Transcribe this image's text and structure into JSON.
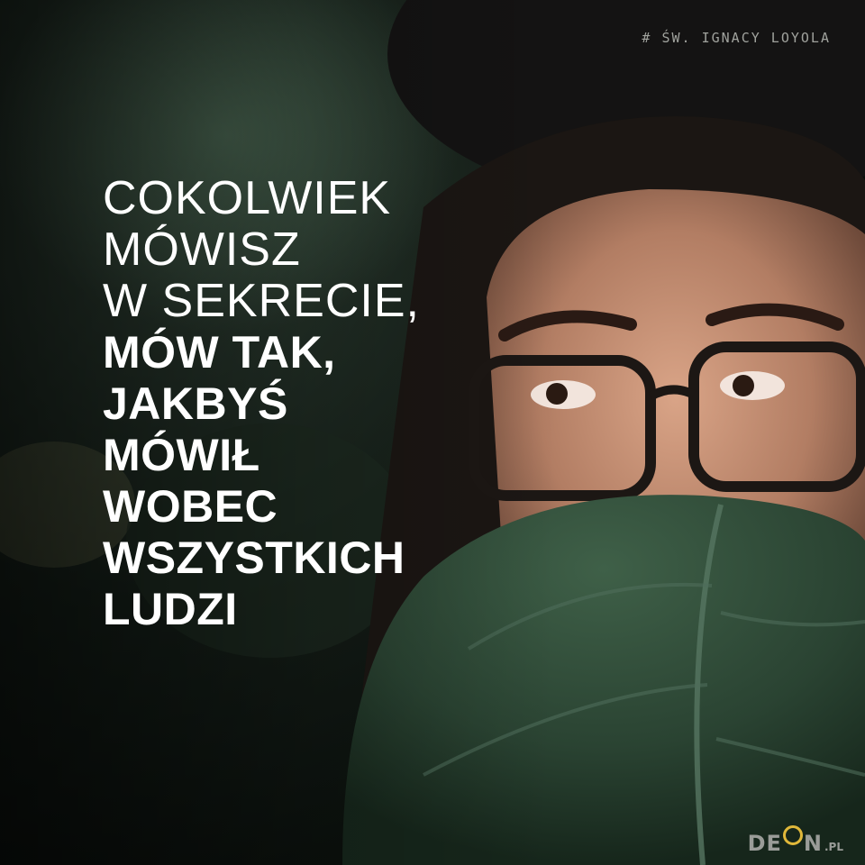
{
  "attribution": "# ŚW. IGNACY LOYOLA",
  "quote": {
    "light_lines": [
      "COKOLWIEK",
      "MÓWISZ",
      "W SEKRECIE,"
    ],
    "bold_lines": [
      "MÓW TAK,",
      "JAKBYŚ",
      "MÓWIŁ",
      "WOBEC",
      "WSZYSTKICH",
      "LUDZI"
    ]
  },
  "logo": {
    "text_start": "DE",
    "text_end": "N",
    "tld": ".PL"
  },
  "colors": {
    "text": "#ffffff",
    "leaf": "#2f4a36",
    "background": "#0e1410",
    "logo_accent": "#e0b83a"
  }
}
